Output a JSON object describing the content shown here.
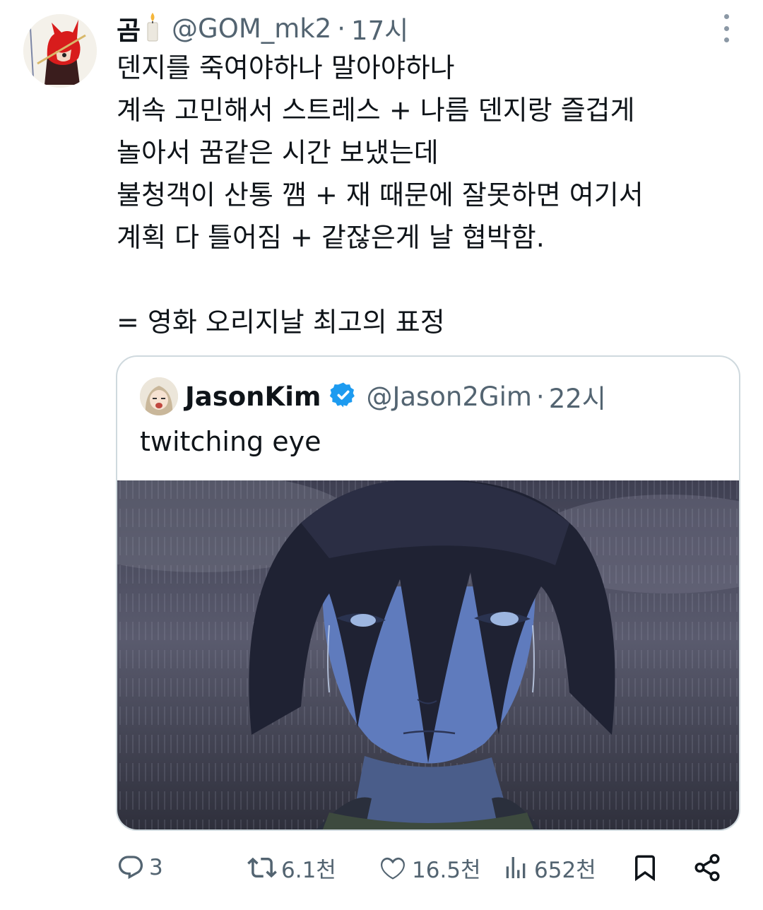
{
  "tweet": {
    "author_name": "곰",
    "author_handle": "@GOM_mk2",
    "separator": "·",
    "time": "17시",
    "text_lines": [
      "덴지를 죽여야하나 말아야하나",
      "계속 고민해서 스트레스 + 나름 덴지랑 즐겁게",
      "놀아서 꿈같은 시간 보냈는데",
      "불청객이 산통 깸 + 재 때문에 잘못하면 여기서",
      "계획 다 틀어짐 + 같잖은게 날 협박함.",
      "",
      "= 영화 오리지날 최고의 표정"
    ]
  },
  "quote": {
    "author_name": "JasonKim",
    "author_handle": "@Jason2Gim",
    "separator": "·",
    "time": "22시",
    "text": "twitching eye"
  },
  "actions": {
    "reply_count": "3",
    "retweet_count": "6.1천",
    "like_count": "16.5천",
    "view_count": "652천"
  },
  "colors": {
    "text_primary": "#0f1419",
    "text_secondary": "#536471",
    "border": "#cfd9de",
    "verified": "#1d9bf0"
  },
  "icons": [
    "more-icon",
    "candle-icon",
    "verified-badge-icon",
    "reply-icon",
    "retweet-icon",
    "like-icon",
    "views-icon",
    "bookmark-icon",
    "share-icon"
  ]
}
